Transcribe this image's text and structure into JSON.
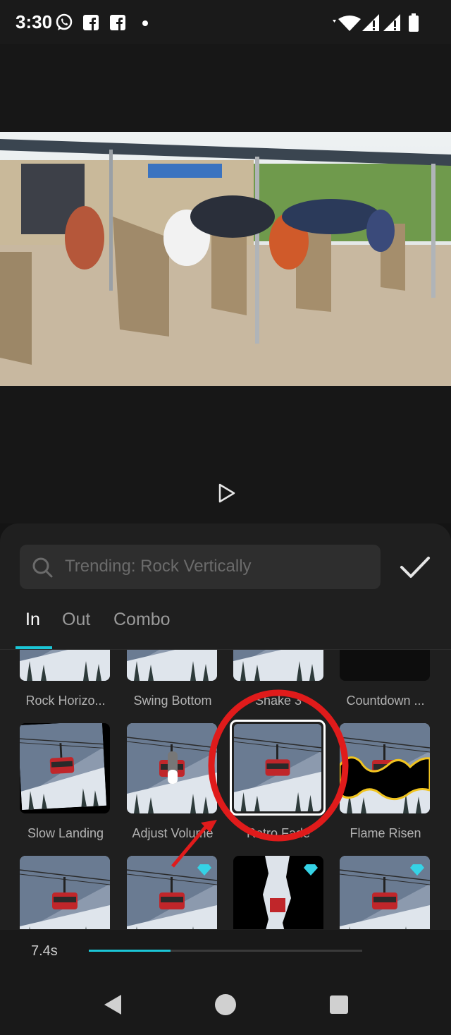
{
  "status_bar": {
    "time": "3:30",
    "icons": [
      "whatsapp-icon",
      "facebook-icon",
      "facebook-icon",
      "dot-icon",
      "wifi-icon",
      "signal-icon",
      "signal-icon",
      "battery-icon"
    ]
  },
  "preview": {
    "play_icon": "play-icon"
  },
  "search": {
    "placeholder": "Trending: Rock Vertically",
    "icon": "search-icon",
    "confirm_icon": "check-icon"
  },
  "tabs": [
    {
      "label": "In",
      "active": true
    },
    {
      "label": "Out",
      "active": false
    },
    {
      "label": "Combo",
      "active": false
    }
  ],
  "animations": {
    "row1": [
      "Rock Horizo...",
      "Swing Bottom",
      "Shake 3",
      "Countdown ..."
    ],
    "row2": [
      "Slow Landing",
      "Adjust Volume",
      "Retro Fade",
      "Flame Risen"
    ],
    "row3_premium": [
      false,
      true,
      true,
      true
    ],
    "selected": "Retro Fade"
  },
  "timeline": {
    "duration": "7.4s",
    "progress": 0.3
  },
  "colors": {
    "accent": "#1bc6d6",
    "annotation": "#e01b1b"
  },
  "nav": [
    "back-icon",
    "home-icon",
    "recents-icon"
  ]
}
